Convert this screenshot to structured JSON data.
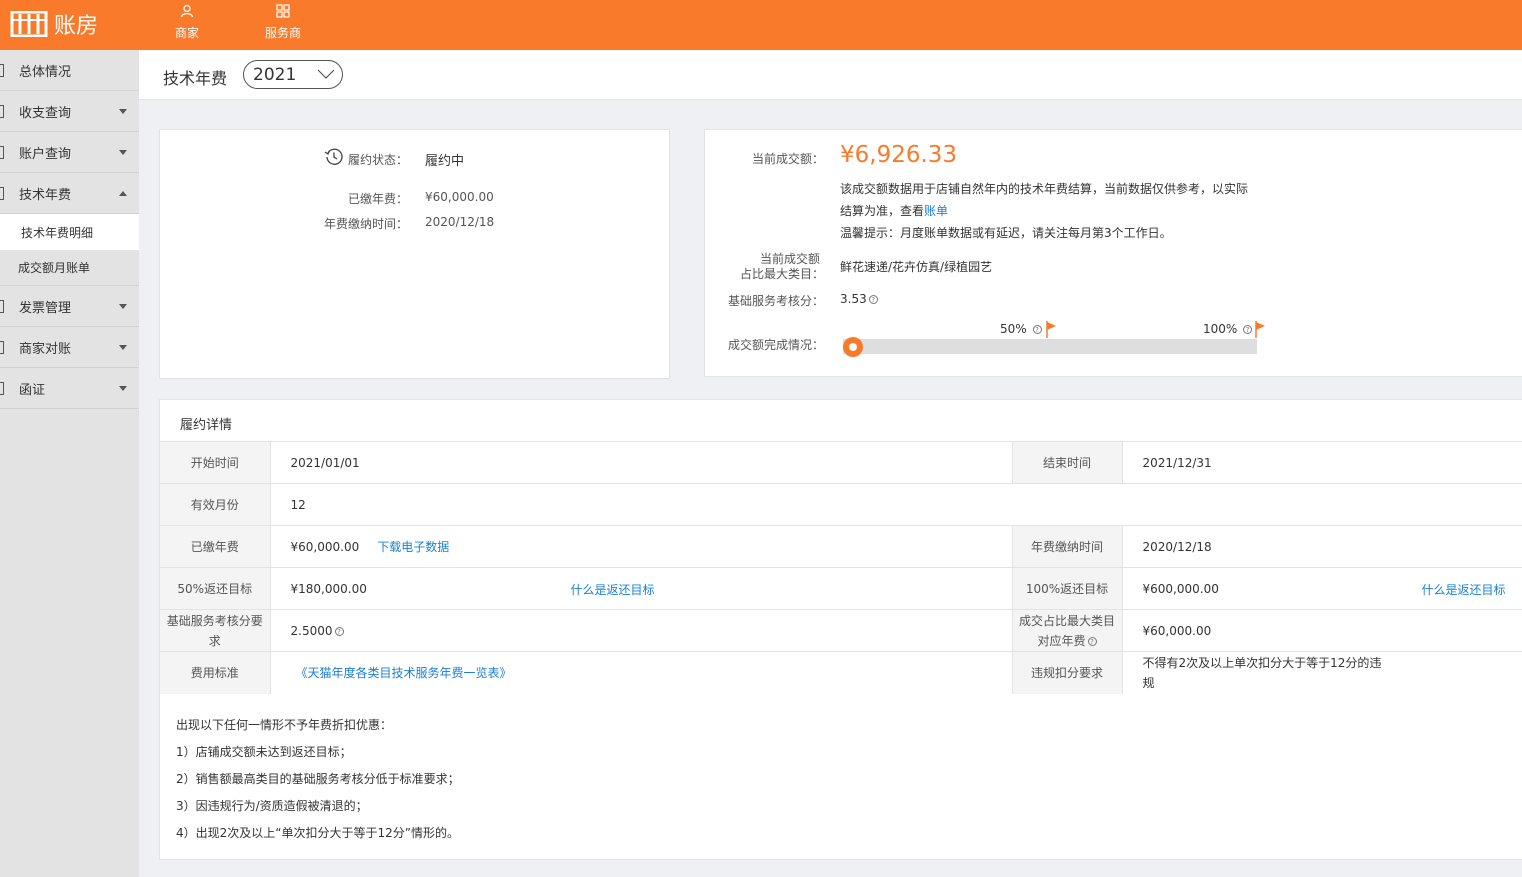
{
  "header": {
    "logo_text": "账房",
    "nav": [
      {
        "label": "商家",
        "icon": "user-icon"
      },
      {
        "label": "服务商",
        "icon": "grid-icon"
      }
    ]
  },
  "sidebar": {
    "items": [
      {
        "label": "总体情况"
      },
      {
        "label": "收支查询"
      },
      {
        "label": "账户查询"
      },
      {
        "label": "技术年费"
      },
      {
        "label": "发票管理"
      },
      {
        "label": "商家对账"
      },
      {
        "label": "函证"
      }
    ],
    "sub_items": [
      {
        "label": "技术年费明细",
        "active": true
      },
      {
        "label": "成交额月账单",
        "active": false
      }
    ]
  },
  "page": {
    "title": "技术年费",
    "year": "2021"
  },
  "status_card": {
    "status_label": "履约状态：",
    "status_value": "履约中",
    "paid_label": "已缴年费：",
    "paid_value": "¥60,000.00",
    "paytime_label": "年费缴纳时间：",
    "paytime_value": "2020/12/18"
  },
  "deal_card": {
    "current_label": "当前成交额：",
    "current_value": "¥6,926.33",
    "desc_line1": "该成交额数据用于店铺自然年内的技术年费结算，当前数据仅供参考，以实际",
    "desc_line2": "结算为准，查看",
    "desc_link": "账单",
    "tip": "温馨提示：月度账单数据或有延迟，请关注每月第3个工作日。",
    "top_cat_label_1": "当前成交额",
    "top_cat_label_2": "占比最大类目：",
    "top_cat_value": "鲜花速递/花卉仿真/绿植园艺",
    "score_label": "基础服务考核分：",
    "score_value": "3.53",
    "progress_label": "成交额完成情况：",
    "marker_50": "50%",
    "marker_100": "100%",
    "progress_fraction": 0.0115
  },
  "details": {
    "title": "履约详情",
    "rows": [
      {
        "k1": "开始时间",
        "v1": "2021/01/01",
        "k2": "结束时间",
        "v2": "2021/12/31"
      },
      {
        "k1": "有效月份",
        "v1": "12"
      },
      {
        "k1": "已缴年费",
        "v1": "¥60,000.00",
        "link1": "下载电子数据",
        "k2": "年费缴纳时间",
        "v2": "2020/12/18"
      },
      {
        "k1": "50%返还目标",
        "v1": "¥180,000.00",
        "link1": "什么是返还目标",
        "k2": "100%返还目标",
        "v2": "¥600,000.00",
        "link2": "什么是返还目标"
      },
      {
        "k1": "基础服务考核分要求",
        "v1": "2.5000",
        "k2a": "成交占比最大类目",
        "k2b": "对应年费",
        "v2": "¥60,000.00"
      },
      {
        "k1": "费用标准",
        "link1": "《天猫年度各类目技术服务年费一览表》",
        "k2": "违规扣分要求",
        "v2": "不得有2次及以上单次扣分大于等于12分的违规"
      }
    ],
    "notes": [
      "出现以下任何一情形不予年费折扣优惠：",
      "1）店铺成交额未达到返还目标；",
      "2）销售额最高类目的基础服务考核分低于标准要求；",
      "3）因违规行为/资质造假被清退的；",
      "4）出现2次及以上“单次扣分大于等于12分”情形的。"
    ]
  }
}
